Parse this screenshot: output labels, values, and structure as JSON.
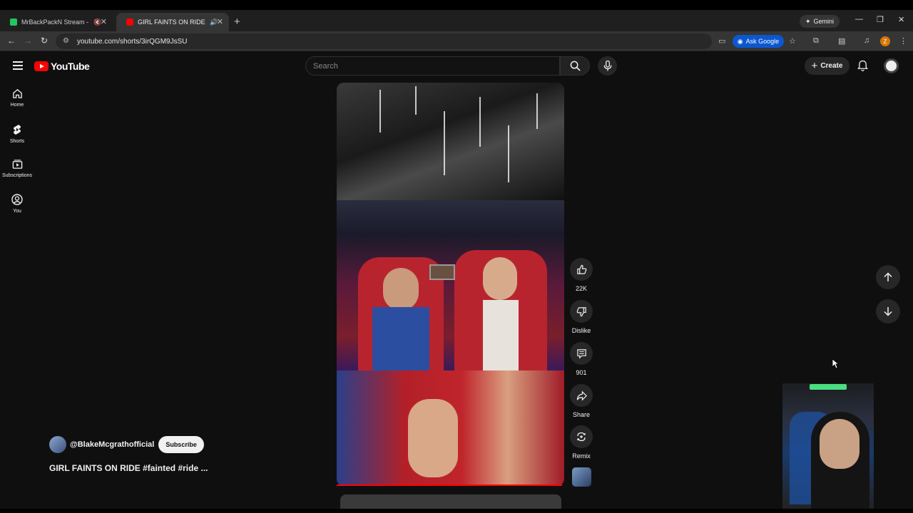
{
  "browser": {
    "tabs": [
      {
        "title": "MrBackPackN Stream - Wat",
        "favicon_color": "#22c55e",
        "active": false
      },
      {
        "title": "GIRL FAINTS ON RIDE #fain",
        "favicon_color": "#ff0000",
        "active": true
      }
    ],
    "gemini_label": "Gemini",
    "url": "youtube.com/shorts/3irQGM9JsSU",
    "ask_google_label": "Ask Google",
    "profile_initial": "Z"
  },
  "youtube": {
    "logo_text": "YouTube",
    "search_placeholder": "Search",
    "create_label": "Create",
    "sidebar": [
      {
        "label": "Home",
        "icon": "home-icon"
      },
      {
        "label": "Shorts",
        "icon": "shorts-icon"
      },
      {
        "label": "Subscriptions",
        "icon": "subscriptions-icon"
      },
      {
        "label": "You",
        "icon": "you-icon"
      }
    ],
    "actions": {
      "like": "22K",
      "dislike": "Dislike",
      "comments": "901",
      "share": "Share",
      "remix": "Remix"
    },
    "channel": {
      "handle": "@BlakeMcgrathofficial",
      "subscribe_label": "Subscribe"
    },
    "video_title": "GIRL FAINTS ON RIDE #fainted #ride ..."
  },
  "colors": {
    "brand_red": "#ff0000",
    "bg": "#0f0f0f",
    "ask_google_blue": "#0b57d0"
  }
}
